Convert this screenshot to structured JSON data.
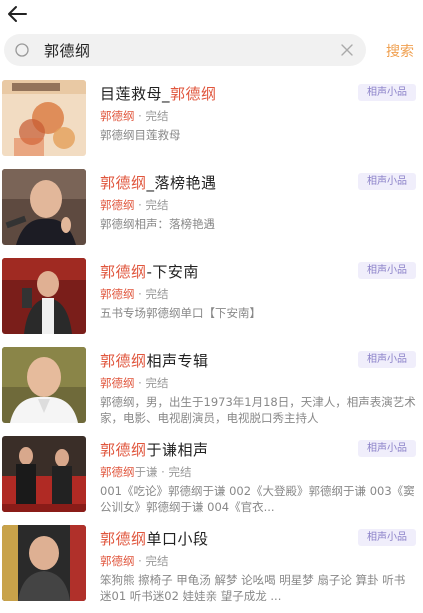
{
  "search": {
    "query": "郭德纲",
    "button_label": "搜索"
  },
  "results": [
    {
      "title_prefix": "目莲救母_",
      "title_highlight": "郭德纲",
      "title_suffix": "",
      "tag": "相声小品",
      "author": "郭德纲",
      "status": "· 完结",
      "description": "郭德纲目莲救母"
    },
    {
      "title_prefix": "",
      "title_highlight": "郭德纲",
      "title_suffix": "_落榜艳遇",
      "tag": "相声小品",
      "author": "郭德纲",
      "status": "· 完结",
      "description": "郭德纲相声：落榜艳遇"
    },
    {
      "title_prefix": "",
      "title_highlight": "郭德纲",
      "title_suffix": "-下安南",
      "tag": "相声小品",
      "author": "郭德纲",
      "status": "· 完结",
      "description": "五书专场郭德纲单口【下安南】"
    },
    {
      "title_prefix": "",
      "title_highlight": "郭德纲",
      "title_suffix": "相声专辑",
      "tag": "相声小品",
      "author": "郭德纲",
      "status": "· 完结",
      "description": "郭德纲，男，出生于1973年1月18日，天津人，相声表演艺术家，电影、电视剧演员，电视脱口秀主持人"
    },
    {
      "title_prefix": "",
      "title_highlight": "郭德纲",
      "title_suffix": "于谦相声",
      "tag": "相声小品",
      "author": "郭德纲",
      "author_suffix": "于谦",
      "status": "· 完结",
      "description": "001《吃论》郭德纲于谦 002《大登殿》郭德纲于谦 003《窦公训女》郭德纲于谦 004《官衣..."
    },
    {
      "title_prefix": "",
      "title_highlight": "郭德纲",
      "title_suffix": "单口小段",
      "tag": "相声小品",
      "author": "郭德纲",
      "status": "· 完结",
      "description": "笨狗熊 擦椅子 甲龟汤 解梦 论吆喝 明星梦 扇子论 算卦 听书迷01 听书迷02 娃娃亲 望子成龙 ..."
    }
  ],
  "colors": {
    "highlight": "#e0563d",
    "accent": "#f0a050",
    "tag_bg": "#f0eefb",
    "tag_text": "#8a80c8"
  }
}
